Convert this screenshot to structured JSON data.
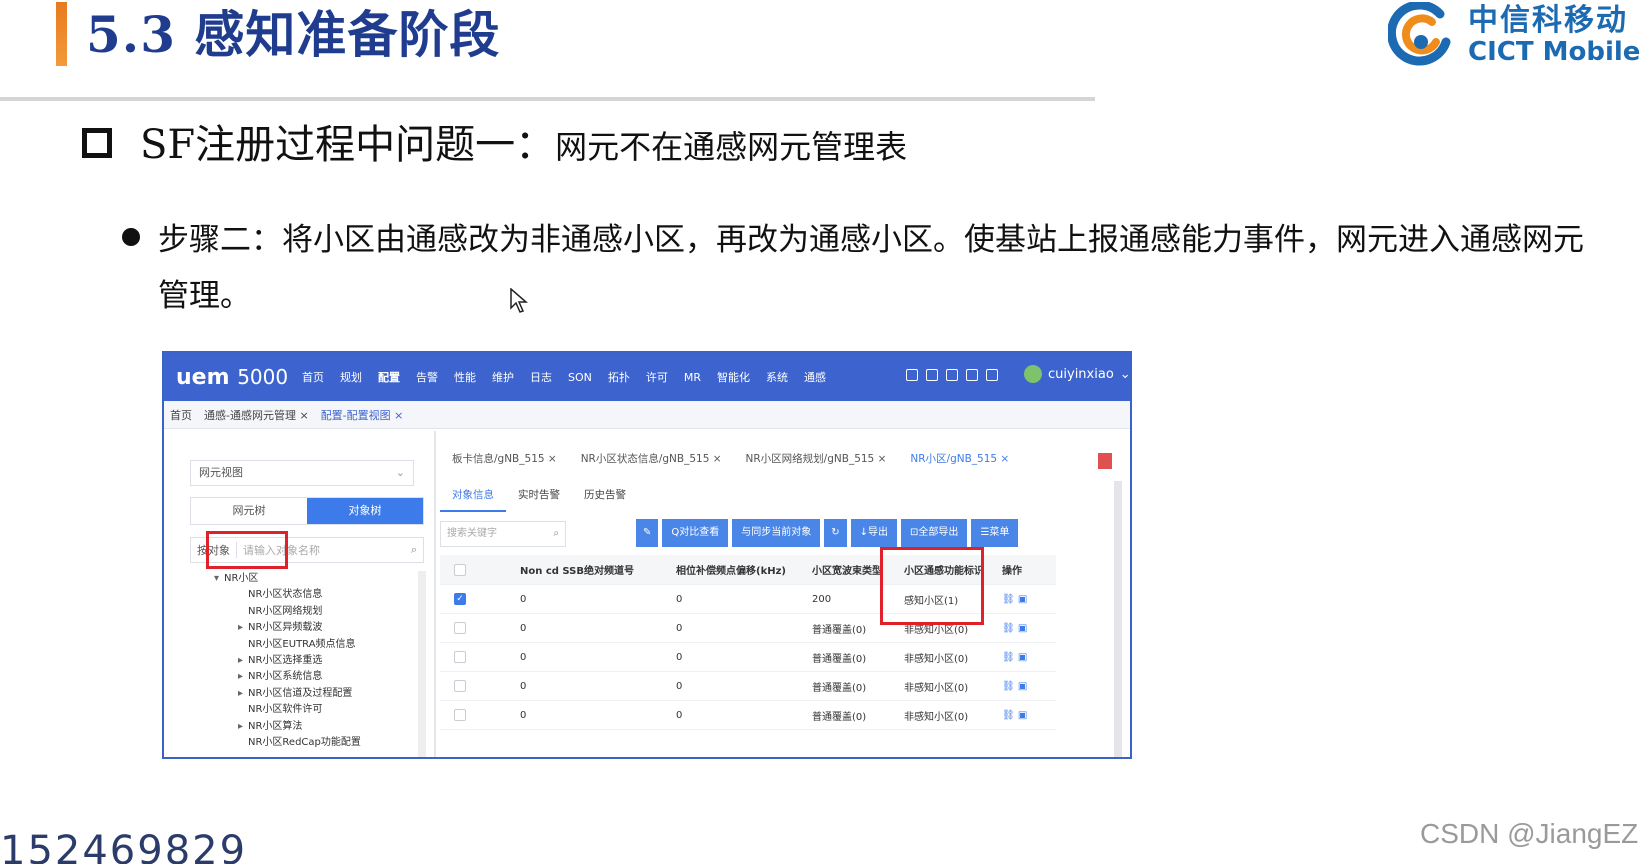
{
  "slide": {
    "section_title": "5.3 感知准备阶段",
    "logo_cn": "中信科移动",
    "logo_en": "CICT Mobile",
    "question_prefix": "SF注册过程中问题一：",
    "question_rest": "网元不在通感网元管理表",
    "step_text": "步骤二：将小区由通感改为非通感小区，再改为通感小区。使基站上报通感能力事件，网元进入通感网元管理。",
    "footer_number": "152469829",
    "watermark": "CSDN @JiangEZ"
  },
  "app": {
    "brand": "uem",
    "brand_version": "5000",
    "menu": [
      "首页",
      "规划",
      "配置",
      "告警",
      "性能",
      "维护",
      "日志",
      "SON",
      "拓扑",
      "许可",
      "MR",
      "智能化",
      "系统",
      "通感"
    ],
    "active_menu": "配置",
    "user": "cuiyinxiao",
    "breadcrumbs": [
      "首页",
      "通感-通感网元管理 ×",
      "配置-配置视图 ×"
    ],
    "left": {
      "view_select": "网元视图",
      "seg_tabs": [
        "网元树",
        "对象树"
      ],
      "search_label": "按对象",
      "search_placeholder": "请输入对象名称",
      "tree_root": "NR小区",
      "tree_items": [
        {
          "arrow": "",
          "label": "NR小区状态信息"
        },
        {
          "arrow": "",
          "label": "NR小区网络规划"
        },
        {
          "arrow": "▸",
          "label": "NR小区异频载波"
        },
        {
          "arrow": "",
          "label": "NR小区EUTRA频点信息"
        },
        {
          "arrow": "▸",
          "label": "NR小区选择重选"
        },
        {
          "arrow": "▸",
          "label": "NR小区系统信息"
        },
        {
          "arrow": "▸",
          "label": "NR小区信道及过程配置"
        },
        {
          "arrow": "",
          "label": "NR小区软件许可"
        },
        {
          "arrow": "▸",
          "label": "NR小区算法"
        },
        {
          "arrow": "",
          "label": "NR小区RedCap功能配置"
        }
      ]
    },
    "right": {
      "tabs": [
        "板卡信息/gNB_515 ×",
        "NR小区状态信息/gNB_515 ×",
        "NR小区网络规划/gNB_515 ×",
        "NR小区/gNB_515 ×"
      ],
      "active_tab": 3,
      "subtabs": [
        "对象信息",
        "实时告警",
        "历史告警"
      ],
      "search_placeholder": "搜索关键字",
      "buttons": [
        "✎",
        "Q对比查看",
        "与同步当前对象",
        "↻",
        "↓导出",
        "⊡全部导出",
        "☰菜单"
      ],
      "columns": [
        "",
        "",
        "Non cd SSB绝对频道号",
        "相位补偿频点偏移(kHz)",
        "小区宽波束类型",
        "小区通感功能标识",
        "操作"
      ],
      "rows": [
        {
          "checked": true,
          "ssb": "0",
          "phase": "0",
          "beam": "200",
          "flag": "感知小区(1)"
        },
        {
          "checked": false,
          "ssb": "0",
          "phase": "0",
          "beam": "普通覆盖(0)",
          "flag": "非感知小区(0)"
        },
        {
          "checked": false,
          "ssb": "0",
          "phase": "0",
          "beam": "普通覆盖(0)",
          "flag": "非感知小区(0)"
        },
        {
          "checked": false,
          "ssb": "0",
          "phase": "0",
          "beam": "普通覆盖(0)",
          "flag": "非感知小区(0)"
        },
        {
          "checked": false,
          "ssb": "0",
          "phase": "0",
          "beam": "普通覆盖(0)",
          "flag": "非感知小区(0)"
        }
      ]
    }
  },
  "colors": {
    "title": "#1f3c8f",
    "accent_bar": "#e87a1e",
    "app_blue": "#3d63cf",
    "highlight_red": "#e0202a"
  }
}
